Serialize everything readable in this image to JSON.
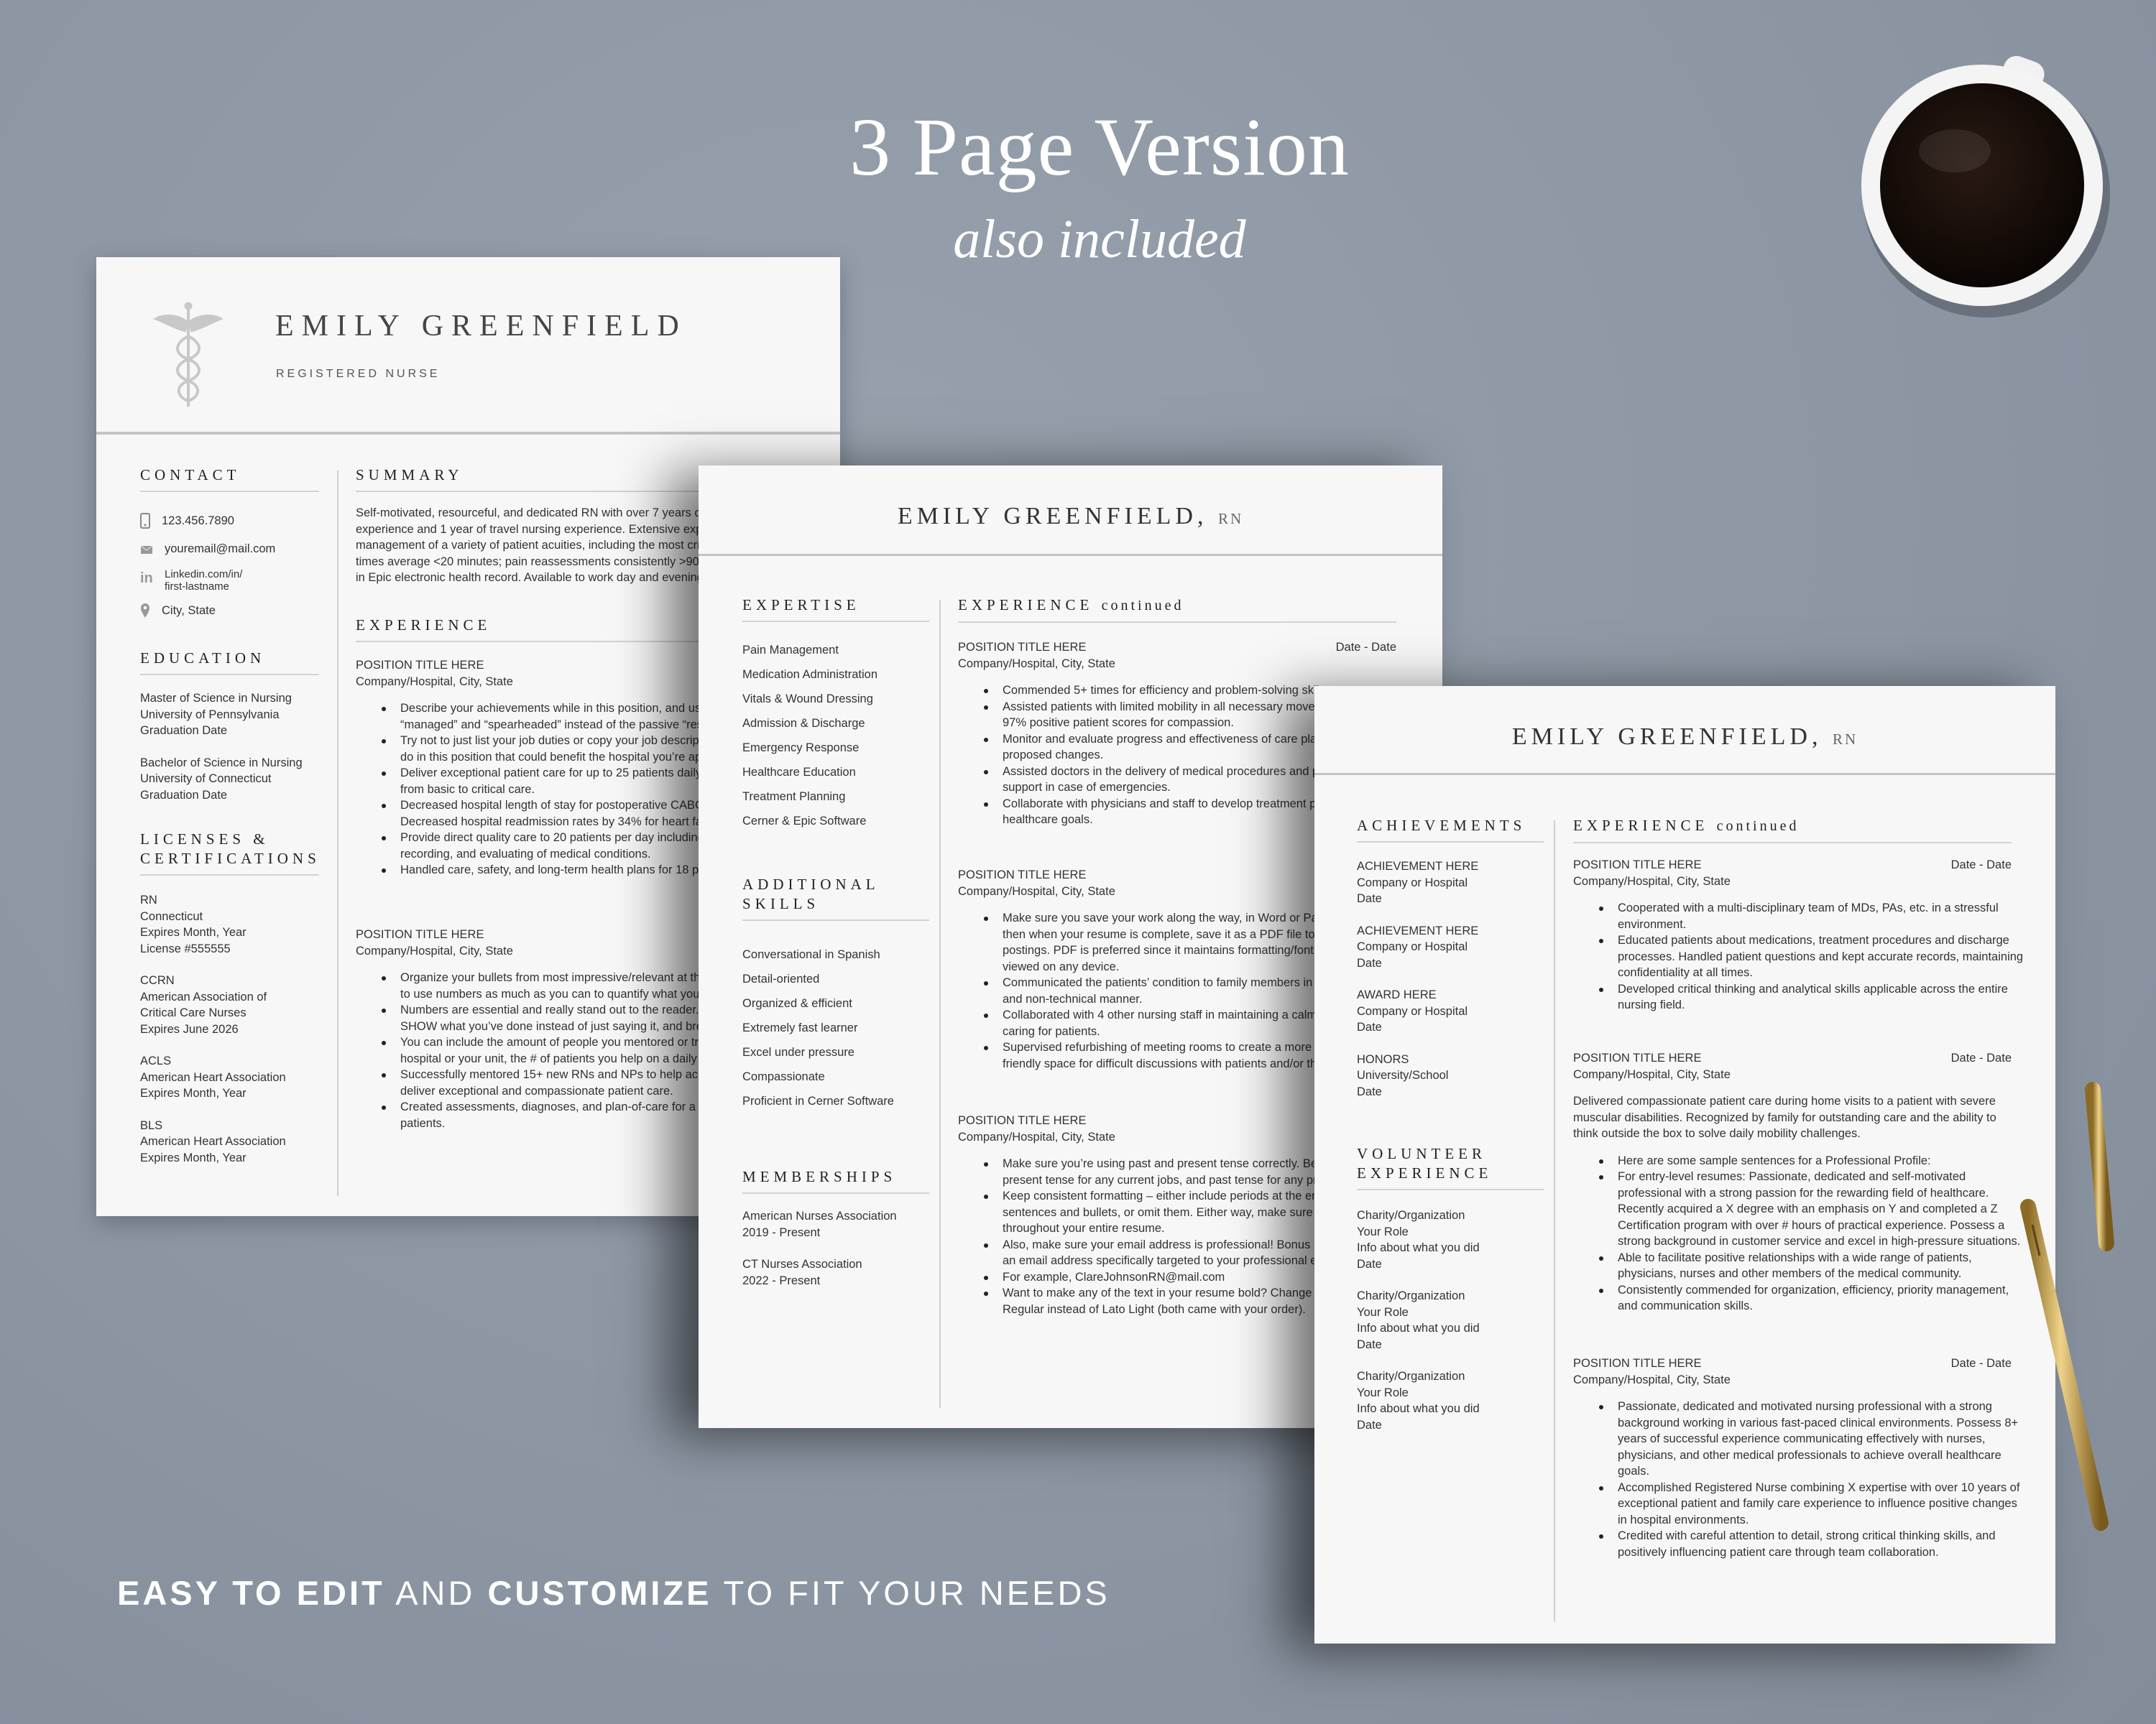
{
  "hero": {
    "title": "3 Page Version",
    "subtitle": "also included"
  },
  "footer": {
    "part1": "EASY TO EDIT",
    "part2": "AND",
    "part3": "CUSTOMIZE",
    "part4": "TO FIT YOUR NEEDS"
  },
  "colors": {
    "background": "#8e98a5",
    "paper": "#f7f7f7",
    "text": "#333333",
    "pen": "#c9a14a"
  },
  "page1": {
    "name": "EMILY GREENFIELD",
    "title": "REGISTERED NURSE",
    "contact": {
      "heading": "CONTACT",
      "phone": "123.456.7890",
      "email": "youremail@mail.com",
      "linkedin_1": "Linkedin.com/in/",
      "linkedin_2": "first-lastname",
      "location": "City, State"
    },
    "education": {
      "heading": "EDUCATION",
      "entries": [
        [
          "Master of Science in Nursing",
          "University of Pennsylvania",
          "Graduation Date"
        ],
        [
          "Bachelor of Science in Nursing",
          "University of Connecticut",
          "Graduation Date"
        ]
      ]
    },
    "licenses": {
      "heading_1": "LICENSES &",
      "heading_2": "CERTIFICATIONS",
      "entries": [
        [
          "RN",
          "Connecticut",
          "Expires Month, Year",
          "License #555555"
        ],
        [
          "CCRN",
          "American Association of",
          "Critical Care Nurses",
          "Expires June 2026"
        ],
        [
          "ACLS",
          "American Heart Association",
          "Expires Month, Year"
        ],
        [
          "BLS",
          "American Heart Association",
          "Expires Month, Year"
        ]
      ]
    },
    "summary": {
      "heading": "SUMMARY",
      "lines": [
        "Self-motivated, resourceful, and dedicated RN with over 7 years of",
        "experience and 1 year of travel nursing experience. Extensive exper",
        "management of a variety of patient acuities, including the most criti",
        "times average <20 minutes; pain reassessments consistently >90%.",
        "in Epic electronic health record. Available to work day and evening s"
      ]
    },
    "experience": {
      "heading": "EXPERIENCE",
      "jobs": [
        {
          "title": "POSITION TITLE HERE",
          "company": "Company/Hospital, City, State",
          "bullets": [
            [
              "Describe your achievements while in this position, and use",
              "“managed” and “spearheaded” instead of the passive “respo"
            ],
            [
              "Try not to just list your job duties or copy your job descripti",
              "do in this position that could benefit the hospital you’re app"
            ],
            [
              "Deliver exceptional patient care for up to 25 patients daily",
              "from basic to critical care."
            ],
            [
              "Decreased hospital length of stay for postoperative CABG",
              "Decreased hospital readmission rates by 34% for heart fail"
            ],
            [
              "Provide direct quality care to 20 patients per day including",
              "recording, and evaluating of medical conditions."
            ],
            [
              "Handled care, safety, and long-term health plans for 18 pat"
            ]
          ]
        },
        {
          "title": "POSITION TITLE HERE",
          "company": "Company/Hospital, City, State",
          "bullets": [
            [
              "Organize your bullets from most impressive/relevant at the",
              "to use numbers as much as you can to quantify what you’ve"
            ],
            [
              "Numbers are essential and really stand out to the reader.  T",
              "SHOW what you’ve done instead of just saying it, and breal"
            ],
            [
              "You can include the amount of people you mentored or trai",
              "hospital or your unit, the # of patients you help on a daily ba"
            ],
            [
              "Successfully mentored 15+ new RNs and NPs to help achie",
              "deliver exceptional and compassionate patient care."
            ],
            [
              "Created assessments, diagnoses, and plan-of-care for a high",
              "patients."
            ]
          ]
        }
      ]
    }
  },
  "page2": {
    "name": "EMILY GREENFIELD,",
    "suffix": "RN",
    "expertise": {
      "heading": "EXPERTISE",
      "items": [
        "Pain Management",
        "Medication Administration",
        "Vitals & Wound Dressing",
        "Admission & Discharge",
        "Emergency Response",
        "Healthcare Education",
        "Treatment Planning",
        "Cerner & Epic Software"
      ]
    },
    "skills": {
      "heading_1": "ADDITIONAL",
      "heading_2": "SKILLS",
      "items": [
        "Conversational in Spanish",
        "Detail-oriented",
        "Organized & efficient",
        "Extremely fast learner",
        "Excel under pressure",
        "Compassionate",
        "Proficient in Cerner Software"
      ]
    },
    "memberships": {
      "heading": "MEMBERSHIPS",
      "entries": [
        [
          "American Nurses Association",
          "2019 - Present"
        ],
        [
          "CT Nurses Association",
          "2022 - Present"
        ]
      ]
    },
    "experience": {
      "heading": "EXPERIENCE",
      "heading_suffix": "continued",
      "jobs": [
        {
          "title": "POSITION TITLE HERE",
          "date": "Date - Date",
          "company": "Company/Hospital, City, State",
          "bullets": [
            [
              "Commended 5+ times for efficiency and problem-solving skil"
            ],
            [
              "Assisted patients with limited mobility in all necessary movem",
              "97% positive patient scores for compassion."
            ],
            [
              "Monitor and evaluate progress and effectiveness of care plan",
              "proposed changes."
            ],
            [
              "Assisted doctors in the delivery of medical procedures and pr",
              "support in case of emergencies."
            ],
            [
              "Collaborate with physicians and staff to develop treatment pl",
              "healthcare goals."
            ]
          ]
        },
        {
          "title": "POSITION TITLE HERE",
          "company": "Company/Hospital, City, State",
          "bullets": [
            [
              "Make sure you save your work along the way, in Word or Pag",
              "then when your resume is complete, save it as a PDF file to up",
              "postings. PDF is preferred since it maintains formatting/fonts",
              "viewed on any device."
            ],
            [
              "Communicated the patients’ condition to family members in a",
              "and non-technical manner."
            ],
            [
              "Collaborated with 4 other nursing staff in maintaining a calm",
              "caring for patients."
            ],
            [
              "Supervised refurbishing of meeting rooms to create a more co",
              "friendly space for difficult discussions with patients and/or th"
            ]
          ]
        },
        {
          "title": "POSITION TITLE HERE",
          "company": "Company/Hospital, City, State",
          "bullets": [
            [
              "Make sure you’re using past and present tense correctly. Be s",
              "present tense for any current jobs, and past tense for any pre"
            ],
            [
              "Keep consistent formatting – either include periods at the en",
              "sentences and bullets, or omit them.  Either way, make sure it",
              "throughout your entire resume."
            ],
            [
              "Also, make sure your email address is professional!  Bonus po",
              "an email address specifically targeted to your professional ex"
            ],
            [
              "For example, ClareJohnsonRN@mail.com"
            ],
            [
              "Want to make any of the text in your resume bold?  Change th",
              "Regular instead of Lato Light (both came with your order)."
            ]
          ]
        }
      ]
    }
  },
  "page3": {
    "name": "EMILY GREENFIELD,",
    "suffix": "RN",
    "achievements": {
      "heading": "ACHIEVEMENTS",
      "entries": [
        [
          "ACHIEVEMENT HERE",
          "Company or Hospital",
          "Date"
        ],
        [
          "ACHIEVEMENT HERE",
          "Company or Hospital",
          "Date"
        ],
        [
          "AWARD HERE",
          "Company or Hospital",
          "Date"
        ],
        [
          "HONORS",
          "University/School",
          "Date"
        ]
      ]
    },
    "volunteer": {
      "heading_1": "VOLUNTEER",
      "heading_2": "EXPERIENCE",
      "entries": [
        [
          "Charity/Organization",
          "Your Role",
          "Info about what you did",
          "Date"
        ],
        [
          "Charity/Organization",
          "Your Role",
          "Info about what you did",
          "Date"
        ],
        [
          "Charity/Organization",
          "Your Role",
          "Info about what you did",
          "Date"
        ]
      ]
    },
    "experience": {
      "heading": "EXPERIENCE",
      "heading_suffix": "continued",
      "jobs": [
        {
          "title": "POSITION TITLE HERE",
          "date": "Date - Date",
          "company": "Company/Hospital, City, State",
          "bullets": [
            [
              "Cooperated with a multi-disciplinary team of MDs, PAs, etc. in a stressful",
              "environment."
            ],
            [
              "Educated patients about medications, treatment procedures and discharge",
              "processes. Handled patient questions and kept accurate records, maintaining",
              "confidentiality at all times."
            ],
            [
              "Developed critical thinking and analytical skills applicable across the entire",
              "nursing field."
            ]
          ]
        },
        {
          "title": "POSITION TITLE HERE",
          "date": "Date - Date",
          "company": "Company/Hospital, City, State",
          "paragraph": [
            "Delivered compassionate patient care during home visits to a patient with severe",
            "muscular disabilities.   Recognized by family for outstanding care and the ability to",
            "think outside the box to solve daily mobility challenges."
          ],
          "bullets": [
            [
              "Here are some sample sentences for a Professional Profile:"
            ],
            [
              "For entry-level resumes: Passionate, dedicated and self-motivated",
              "professional with a strong passion for the rewarding field of healthcare.",
              "Recently acquired a X degree with an emphasis on Y and completed a Z",
              "Certification program with over # hours of practical experience. Possess a",
              "strong background in customer service and excel in high-pressure situations."
            ],
            [
              "Able to facilitate positive relationships with a wide range of patients,",
              "physicians, nurses and other members of the medical community."
            ],
            [
              "Consistently commended for organization, efficiency, priority management,",
              "and communication skills."
            ]
          ]
        },
        {
          "title": "POSITION TITLE HERE",
          "date": "Date - Date",
          "company": "Company/Hospital, City, State",
          "bullets": [
            [
              "Passionate, dedicated and motivated nursing professional with a strong",
              "background working in various fast-paced clinical environments. Possess 8+",
              "years of successful experience communicating effectively with nurses,",
              "physicians, and other medical professionals to achieve overall healthcare",
              "goals."
            ],
            [
              "Accomplished Registered Nurse combining X expertise with over 10 years of",
              "exceptional patient and family care experience to influence positive changes",
              "in hospital environments."
            ],
            [
              "Credited with careful attention to detail, strong critical thinking skills, and",
              "positively influencing patient care through team collaboration."
            ]
          ]
        }
      ]
    }
  }
}
